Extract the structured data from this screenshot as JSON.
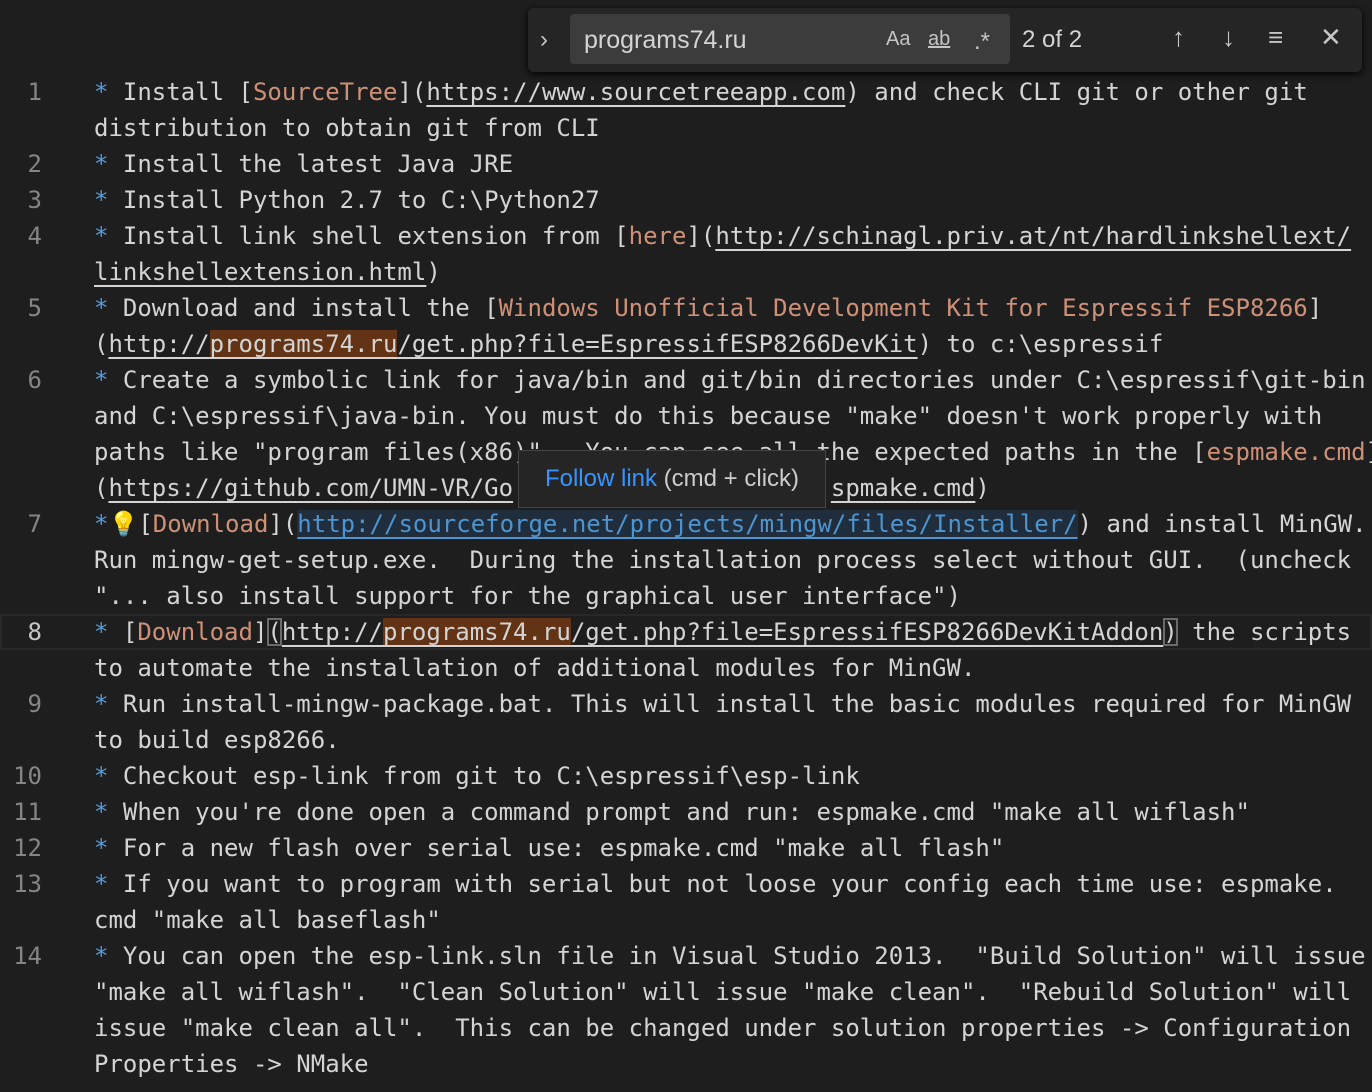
{
  "find_widget": {
    "query": "programs74.ru",
    "match_case_label": "Aa",
    "whole_word_label": "ab",
    "regex_label": ".*",
    "result_count": "2 of 2"
  },
  "tooltip": {
    "link": "Follow link",
    "hint": "(cmd + click)"
  },
  "colors": {
    "background": "#1e1e1e",
    "bullet": "#569cd6",
    "link_text": "#ce9178",
    "find_match": "#623315",
    "hover_link": "#4e94ce"
  },
  "rows": [
    {
      "ln": "1",
      "s": [
        [
          "b",
          "*"
        ],
        [
          "t",
          " Install ["
        ],
        [
          "lt",
          "SourceTree"
        ],
        [
          "t",
          "]("
        ],
        [
          "u",
          "https://www.sourcetreeapp.com"
        ],
        [
          "t",
          ") and check CLI git or other git"
        ]
      ]
    },
    {
      "ln": "",
      "s": [
        [
          "t",
          "distribution to obtain git from CLI"
        ]
      ]
    },
    {
      "ln": "2",
      "s": [
        [
          "b",
          "*"
        ],
        [
          "t",
          " Install the latest Java JRE"
        ]
      ]
    },
    {
      "ln": "3",
      "s": [
        [
          "b",
          "*"
        ],
        [
          "t",
          " Install Python 2.7 to C:\\Python27"
        ]
      ]
    },
    {
      "ln": "4",
      "s": [
        [
          "b",
          "*"
        ],
        [
          "t",
          " Install link shell extension from ["
        ],
        [
          "lt",
          "here"
        ],
        [
          "t",
          "]("
        ],
        [
          "u",
          "http://schinagl.priv.at/nt/hardlinkshellext/"
        ]
      ]
    },
    {
      "ln": "",
      "s": [
        [
          "u",
          "linkshellextension.html"
        ],
        [
          "t",
          ")"
        ]
      ]
    },
    {
      "ln": "5",
      "s": [
        [
          "b",
          "*"
        ],
        [
          "t",
          " Download and install the ["
        ],
        [
          "lt",
          "Windows Unofficial Development Kit for Espressif ESP8266"
        ],
        [
          "t",
          "]"
        ]
      ]
    },
    {
      "ln": "",
      "s": [
        [
          "t",
          "("
        ],
        [
          "u",
          "http://"
        ],
        [
          "um",
          "programs74.ru"
        ],
        [
          "u",
          "/get.php?file=EspressifESP8266DevKit"
        ],
        [
          "t",
          ") to c:\\espressif"
        ]
      ]
    },
    {
      "ln": "6",
      "s": [
        [
          "b",
          "*"
        ],
        [
          "t",
          " Create a symbolic link for java/bin and git/bin directories under C:\\espressif\\git-bin"
        ]
      ]
    },
    {
      "ln": "",
      "s": [
        [
          "t",
          "and C:\\espressif\\java-bin. You must do this because \"make\" doesn't work properly with"
        ]
      ]
    },
    {
      "ln": "",
      "s": [
        [
          "t",
          "paths like \"program files(x86)\".  You can see all the expected paths in the ["
        ],
        [
          "lt",
          "espmake.cmd"
        ],
        [
          "t",
          "]"
        ]
      ]
    },
    {
      "ln": "",
      "s": [
        [
          "t",
          "("
        ],
        [
          "u",
          "https://github.com/UMN-VR/Go"
        ],
        [
          "gap",
          ""
        ],
        [
          "u",
          "spmake.cmd"
        ],
        [
          "t",
          ")"
        ]
      ]
    },
    {
      "ln": "7",
      "s": [
        [
          "b",
          "*"
        ],
        [
          "bulb",
          "💡"
        ],
        [
          "t",
          "["
        ],
        [
          "lt",
          "Download"
        ],
        [
          "t",
          "]("
        ],
        [
          "h",
          "http://sourceforge.net/projects/mingw/files/Installer/"
        ],
        [
          "t",
          ") and install MinGW."
        ]
      ]
    },
    {
      "ln": "",
      "s": [
        [
          "t",
          "Run mingw-get-setup.exe.  During the installation process select without GUI.  (uncheck"
        ]
      ]
    },
    {
      "ln": "",
      "s": [
        [
          "t",
          "\"... also install support for the graphical user interface\")"
        ]
      ]
    },
    {
      "ln": "8",
      "cur": true,
      "s": [
        [
          "b",
          "*"
        ],
        [
          "t",
          " ["
        ],
        [
          "lt",
          "Download"
        ],
        [
          "t",
          "]"
        ],
        [
          "br",
          "("
        ],
        [
          "u",
          "http://"
        ],
        [
          "um",
          "programs74.ru"
        ],
        [
          "u",
          "/get.php?file=EspressifESP8266DevKitAddon"
        ],
        [
          "br",
          ")"
        ],
        [
          "t",
          " the scripts"
        ]
      ]
    },
    {
      "ln": "",
      "s": [
        [
          "t",
          "to automate the installation of additional modules for MinGW."
        ]
      ]
    },
    {
      "ln": "9",
      "s": [
        [
          "b",
          "*"
        ],
        [
          "t",
          " Run install-mingw-package.bat. This will install the basic modules required for MinGW"
        ]
      ]
    },
    {
      "ln": "",
      "s": [
        [
          "t",
          "to build esp8266."
        ]
      ]
    },
    {
      "ln": "10",
      "s": [
        [
          "b",
          "*"
        ],
        [
          "t",
          " Checkout esp-link from git to C:\\espressif\\esp-link"
        ]
      ]
    },
    {
      "ln": "11",
      "s": [
        [
          "b",
          "*"
        ],
        [
          "t",
          " When you're done open a command prompt and run: espmake.cmd \"make all wiflash\""
        ]
      ]
    },
    {
      "ln": "12",
      "s": [
        [
          "b",
          "*"
        ],
        [
          "t",
          " For a new flash over serial use: espmake.cmd \"make all flash\""
        ]
      ]
    },
    {
      "ln": "13",
      "s": [
        [
          "b",
          "*"
        ],
        [
          "t",
          " If you want to program with serial but not loose your config each time use: espmake."
        ]
      ]
    },
    {
      "ln": "",
      "s": [
        [
          "t",
          "cmd \"make all baseflash\""
        ]
      ]
    },
    {
      "ln": "14",
      "s": [
        [
          "b",
          "*"
        ],
        [
          "t",
          " You can open the esp-link.sln file in Visual Studio 2013.  \"Build Solution\" will issue"
        ]
      ]
    },
    {
      "ln": "",
      "s": [
        [
          "t",
          "\"make all wiflash\".  \"Clean Solution\" will issue \"make clean\".  \"Rebuild Solution\" will"
        ]
      ]
    },
    {
      "ln": "",
      "s": [
        [
          "t",
          "issue \"make clean all\".  This can be changed under solution properties -> Configuration"
        ]
      ]
    },
    {
      "ln": "",
      "s": [
        [
          "t",
          "Properties -> NMake"
        ]
      ]
    }
  ]
}
